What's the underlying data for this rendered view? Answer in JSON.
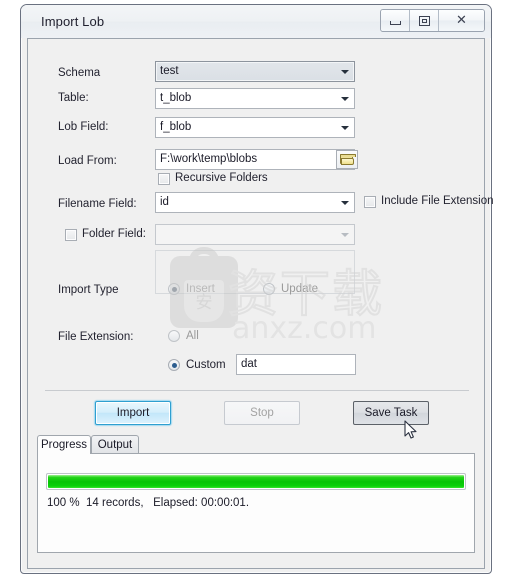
{
  "window": {
    "title": "Import Lob",
    "controls": {
      "minimize": "minimize-button",
      "restore": "restore-button",
      "close": "close-button",
      "close_glyph": "✕"
    }
  },
  "form": {
    "schema": {
      "label": "Schema",
      "value": "test"
    },
    "table": {
      "label": "Table:",
      "value": "t_blob"
    },
    "lob_field": {
      "label": "Lob Field:",
      "value": "f_blob"
    },
    "load_from": {
      "label": "Load From:",
      "value": "F:\\work\\temp\\blobs",
      "browse_icon": "folder-icon"
    },
    "recursive_folders": {
      "label": "Recursive Folders",
      "checked": false
    },
    "filename_field": {
      "label": "Filename Field:",
      "value": "id"
    },
    "include_file_extension": {
      "label": "Include File Extension",
      "checked": false
    },
    "folder_field": {
      "label": "Folder Field:",
      "checked": false,
      "value": "",
      "enabled": false
    },
    "import_type": {
      "label": "Import Type",
      "options": [
        "Insert",
        "Update"
      ],
      "selected": "Insert"
    },
    "file_extension": {
      "label": "File Extension:",
      "options": [
        "All",
        "Custom"
      ],
      "selected": "Custom",
      "custom_value": "dat"
    }
  },
  "actions": {
    "import": "Import",
    "stop": "Stop",
    "save_task": "Save Task"
  },
  "tabs": [
    {
      "label": "Progress",
      "active": true
    },
    {
      "label": "Output",
      "active": false
    }
  ],
  "progress": {
    "percent": 100,
    "bar_color": "#06c406",
    "status": "100 %  14 records,   Elapsed: 00:00:01."
  },
  "watermark": {
    "cn_text": "资下载",
    "badge_text": "安",
    "url": "anxz.com"
  }
}
